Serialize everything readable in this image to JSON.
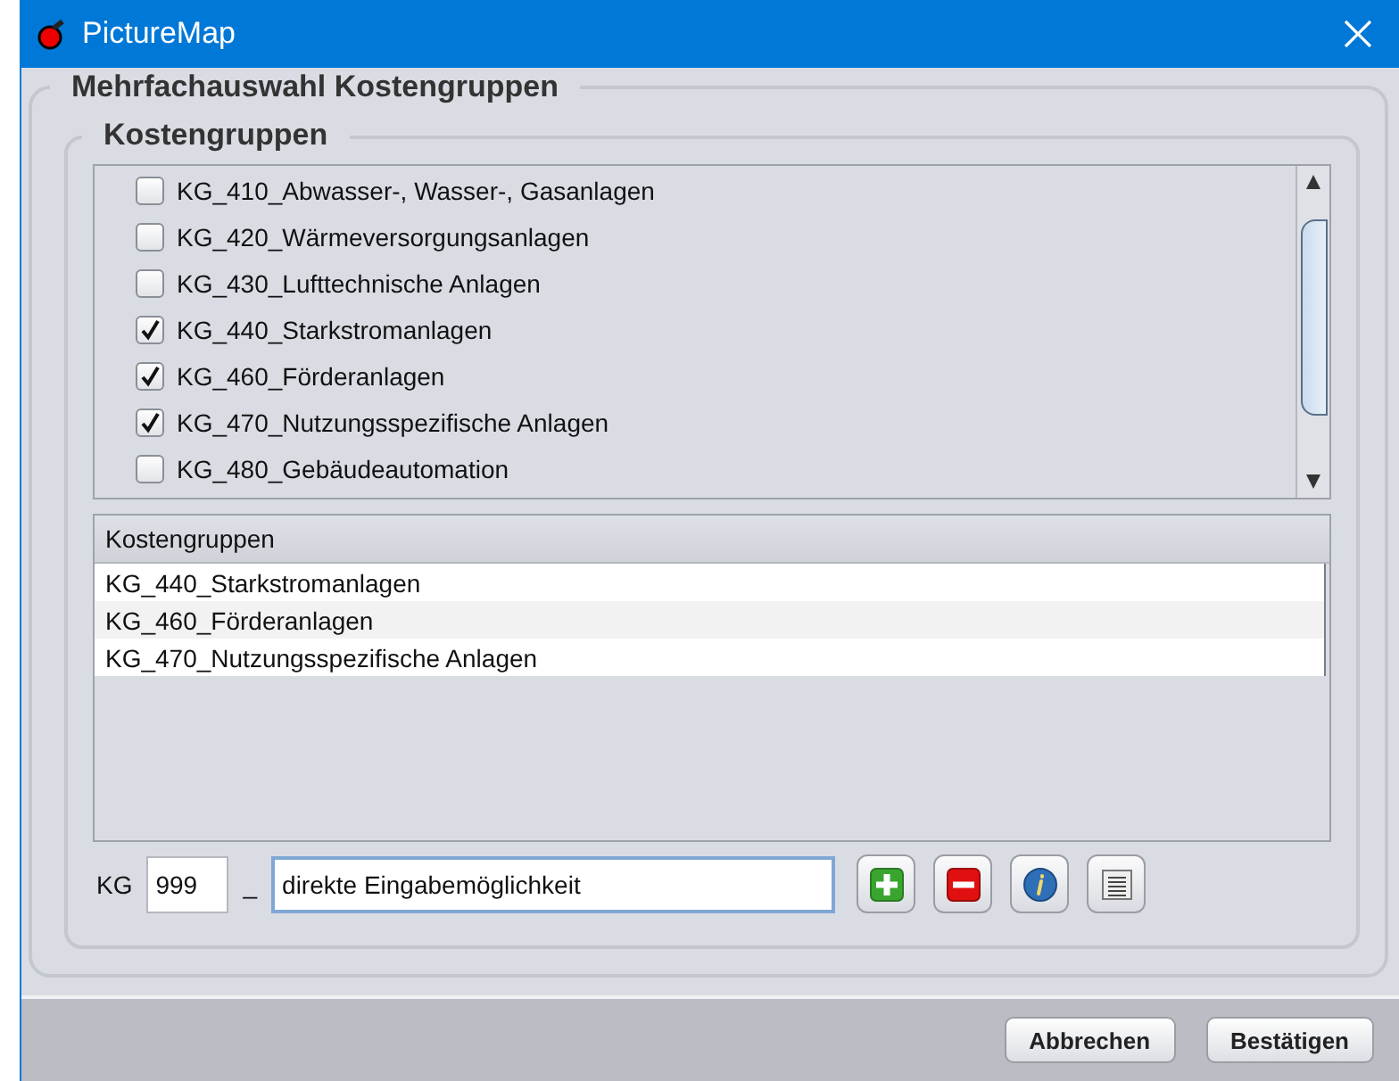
{
  "window": {
    "title": "PictureMap"
  },
  "outer_group": {
    "title": "Mehrfachauswahl Kostengruppen"
  },
  "inner_group": {
    "title": "Kostengruppen"
  },
  "checklist": [
    {
      "label": "KG_410_Abwasser-, Wasser-, Gasanlagen",
      "checked": false
    },
    {
      "label": "KG_420_Wärmeversorgungsanlagen",
      "checked": false
    },
    {
      "label": "KG_430_Lufttechnische Anlagen",
      "checked": false
    },
    {
      "label": "KG_440_Starkstromanlagen",
      "checked": true
    },
    {
      "label": "KG_460_Förderanlagen",
      "checked": true
    },
    {
      "label": "KG_470_Nutzungsspezifische Anlagen",
      "checked": true
    },
    {
      "label": "KG_480_Gebäudeautomation",
      "checked": false
    }
  ],
  "table": {
    "columns": [
      "Kostengruppen"
    ],
    "rows": [
      "KG_440_Starkstromanlagen",
      "KG_460_Förderanlagen",
      "KG_470_Nutzungsspezifische Anlagen"
    ]
  },
  "entry": {
    "prefix_label": "KG",
    "number": "999",
    "separator": "_",
    "text": "direkte Eingabemöglichkeit"
  },
  "tool_buttons": [
    {
      "kind": "add"
    },
    {
      "kind": "remove"
    },
    {
      "kind": "info"
    },
    {
      "kind": "list"
    }
  ],
  "buttons": [
    "Abbrechen",
    "Bestätigen"
  ]
}
